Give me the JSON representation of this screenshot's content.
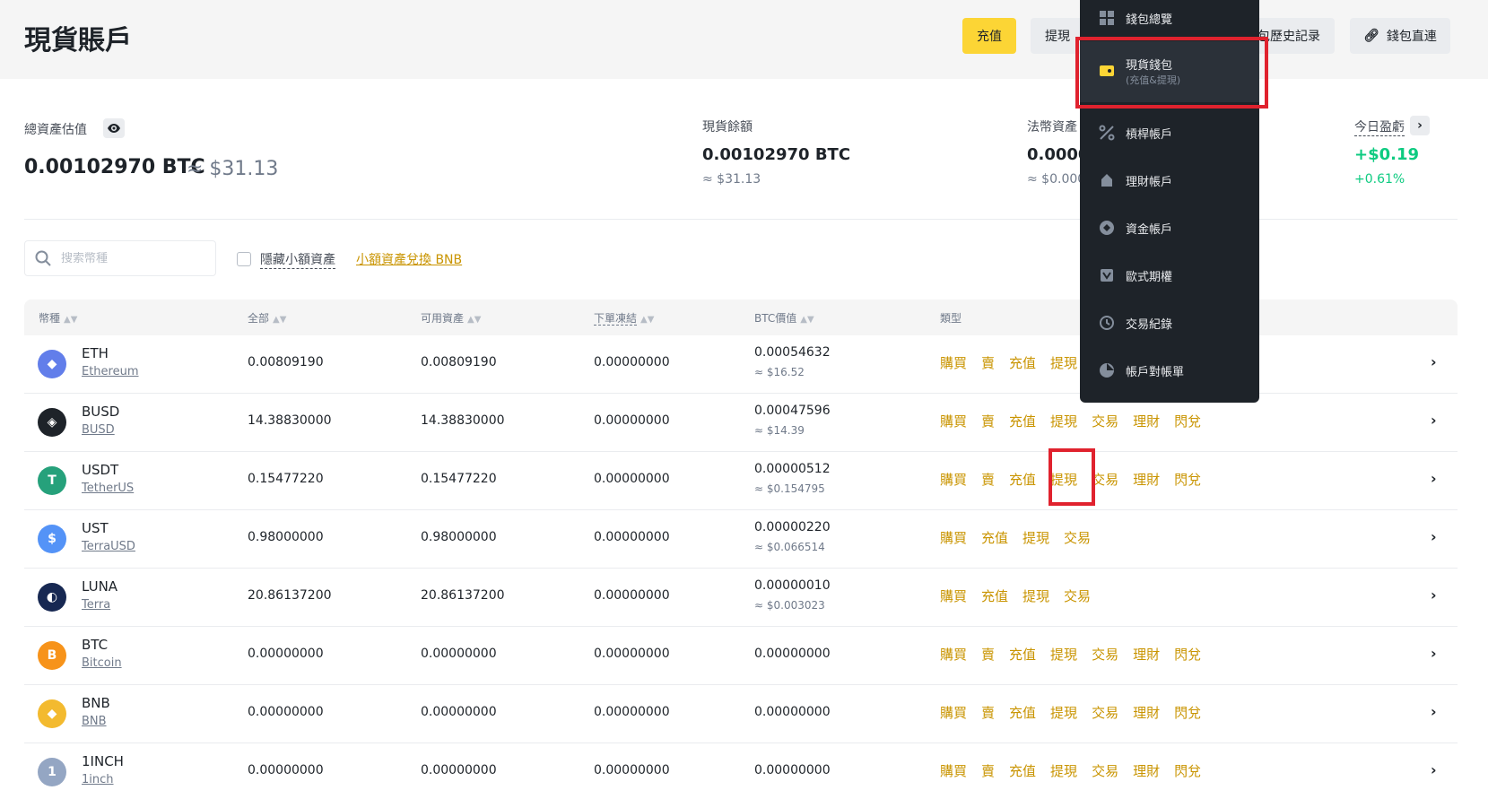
{
  "header": {
    "title": "現貨賬戶",
    "deposit_label": "充值",
    "withdraw_label": "提現",
    "history_label": "錢包歷史記录",
    "direct_link_label": "錢包直連"
  },
  "summary": {
    "total_label": "總資產估值",
    "total_btc": "0.00102970 BTC",
    "total_usd": "≈ $31.13",
    "spot_label": "現貨餘額",
    "spot_btc": "0.00102970 BTC",
    "spot_usd": "≈ $31.13",
    "fiat_label": "法幣資產",
    "fiat_btc": "0.0000",
    "fiat_usd": "≈ $0.000",
    "pnl_label": "今日盈虧",
    "pnl_value": "+$0.19",
    "pnl_percent": "+0.61%"
  },
  "filters": {
    "search_placeholder": "搜索幣種",
    "hide_small_label": "隱藏小額資產",
    "convert_link": "小額資產兌換 BNB"
  },
  "table": {
    "headers": {
      "coin": "幣種",
      "total": "全部",
      "available": "可用資產",
      "in_order": "下單凍結",
      "btc_value": "BTC價值",
      "type": "類型"
    },
    "rows": [
      {
        "symbol": "ETH",
        "name": "Ethereum",
        "total": "0.00809190",
        "available": "0.00809190",
        "in_order": "0.00000000",
        "btc": "0.00054632",
        "usd": "≈ $16.52",
        "icon": "eth-icon",
        "color": "#627eea",
        "glyph": "◆",
        "actions": [
          "購買",
          "賣",
          "充值",
          "提現"
        ]
      },
      {
        "symbol": "BUSD",
        "name": "BUSD",
        "total": "14.38830000",
        "available": "14.38830000",
        "in_order": "0.00000000",
        "btc": "0.00047596",
        "usd": "≈ $14.39",
        "icon": "busd-icon",
        "color": "#1e2329",
        "glyph": "◈",
        "actions": [
          "購買",
          "賣",
          "充值",
          "提現",
          "交易",
          "理財",
          "閃兌"
        ]
      },
      {
        "symbol": "USDT",
        "name": "TetherUS",
        "total": "0.15477220",
        "available": "0.15477220",
        "in_order": "0.00000000",
        "btc": "0.00000512",
        "usd": "≈ $0.154795",
        "icon": "usdt-icon",
        "color": "#26a17b",
        "glyph": "T",
        "actions": [
          "購買",
          "賣",
          "充值",
          "提現",
          "交易",
          "理財",
          "閃兌"
        ]
      },
      {
        "symbol": "UST",
        "name": "TerraUSD",
        "total": "0.98000000",
        "available": "0.98000000",
        "in_order": "0.00000000",
        "btc": "0.00000220",
        "usd": "≈ $0.066514",
        "icon": "ust-icon",
        "color": "#5493f7",
        "glyph": "$",
        "actions": [
          "購買",
          "充值",
          "提現",
          "交易"
        ]
      },
      {
        "symbol": "LUNA",
        "name": "Terra",
        "total": "20.86137200",
        "available": "20.86137200",
        "in_order": "0.00000000",
        "btc": "0.00000010",
        "usd": "≈ $0.003023",
        "icon": "luna-icon",
        "color": "#172852",
        "glyph": "◐",
        "actions": [
          "購買",
          "充值",
          "提現",
          "交易"
        ]
      },
      {
        "symbol": "BTC",
        "name": "Bitcoin",
        "total": "0.00000000",
        "available": "0.00000000",
        "in_order": "0.00000000",
        "btc": "0.00000000",
        "usd": "",
        "icon": "btc-icon",
        "color": "#f7931a",
        "glyph": "B",
        "actions": [
          "購買",
          "賣",
          "充值",
          "提現",
          "交易",
          "理財",
          "閃兌"
        ]
      },
      {
        "symbol": "BNB",
        "name": "BNB",
        "total": "0.00000000",
        "available": "0.00000000",
        "in_order": "0.00000000",
        "btc": "0.00000000",
        "usd": "",
        "icon": "bnb-icon",
        "color": "#f3ba2f",
        "glyph": "◆",
        "actions": [
          "購買",
          "賣",
          "充值",
          "提現",
          "交易",
          "理財",
          "閃兌"
        ]
      },
      {
        "symbol": "1INCH",
        "name": "1inch",
        "total": "0.00000000",
        "available": "0.00000000",
        "in_order": "0.00000000",
        "btc": "0.00000000",
        "usd": "",
        "icon": "1inch-icon",
        "color": "#94a6c3",
        "glyph": "1",
        "actions": [
          "購買",
          "賣",
          "充值",
          "提現",
          "交易",
          "理財",
          "閃兌"
        ]
      }
    ]
  },
  "menu": {
    "items": [
      {
        "label": "錢包總覽",
        "icon": "dashboard-icon"
      },
      {
        "label": "現貨錢包",
        "sub": "(充值&提現)",
        "icon": "spot-wallet-icon"
      },
      {
        "label": "槓桿帳戶",
        "icon": "margin-icon"
      },
      {
        "label": "理財帳戶",
        "icon": "earn-icon"
      },
      {
        "label": "資金帳戶",
        "icon": "funding-icon"
      },
      {
        "label": "歐式期權",
        "icon": "options-icon"
      },
      {
        "label": "交易紀錄",
        "icon": "history-icon"
      },
      {
        "label": "帳戶對帳單",
        "icon": "statement-icon"
      }
    ]
  },
  "colors": {
    "accent": "#fcd535",
    "action": "#c99400",
    "positive": "#0ecb81",
    "highlight": "#e0222e",
    "menu_bg": "#1e2329"
  }
}
